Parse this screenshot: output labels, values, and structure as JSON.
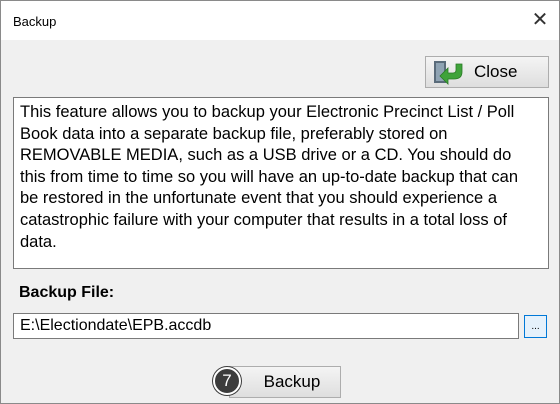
{
  "window": {
    "title": "Backup",
    "close_glyph": "✕"
  },
  "toolbar": {
    "close_label": "Close",
    "close_icon": "exit-arrow-icon"
  },
  "description": "This feature allows you to backup your Electronic Precinct List / Poll Book data into a separate backup file, preferably stored on REMOVABLE MEDIA, such as a USB drive or a CD. You should do this from time to time so you will have an up-to-date backup that can be restored in the unfortunate event that you should experience a catastrophic failure with your computer that results in a total loss of data.",
  "backup_file": {
    "label": "Backup File:",
    "value": "E:\\Electiondate\\EPB.accdb",
    "browse_label": "..."
  },
  "actions": {
    "step_number": "7",
    "backup_label": "Backup"
  },
  "colors": {
    "window_bg": "#f0f0f0",
    "accent": "#0078d7",
    "icon_green": "#3fa33a"
  }
}
